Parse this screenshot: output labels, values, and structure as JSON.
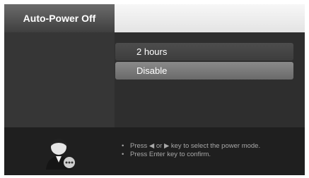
{
  "header": {
    "title": "Auto-Power Off"
  },
  "options": [
    {
      "label": "2 hours",
      "selected": false
    },
    {
      "label": "Disable",
      "selected": true
    }
  ],
  "footer": {
    "icon": "user-avatar-icon",
    "hints": [
      "Press ◀ or ▶ key to select the power mode.",
      "Press Enter key to confirm."
    ]
  },
  "colors": {
    "background": "#2e2e2e",
    "header_tab": "#4f4f4f",
    "selected_option": "#7a7a7a",
    "footer": "#1f1f1f"
  }
}
